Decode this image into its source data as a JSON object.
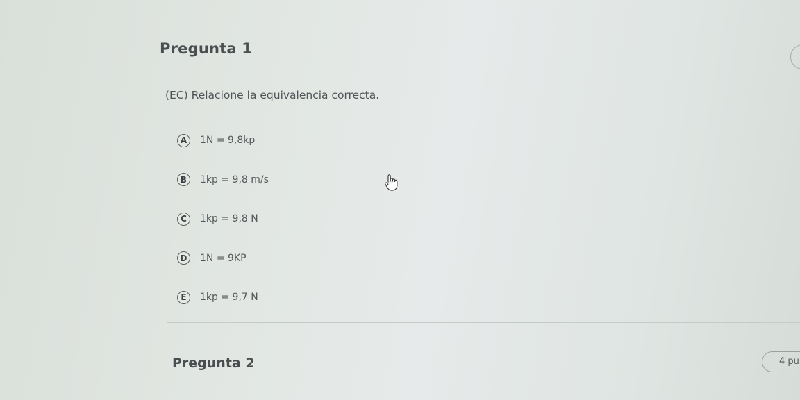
{
  "question1": {
    "title": "Pregunta 1",
    "text": "(EC) Relacione la equivalencia correcta.",
    "options": [
      {
        "letter": "A",
        "text": "1N = 9,8kp"
      },
      {
        "letter": "B",
        "text": "1kp = 9,8 m/s"
      },
      {
        "letter": "C",
        "text": "1kp = 9,8 N"
      },
      {
        "letter": "D",
        "text": "1N = 9KP"
      },
      {
        "letter": "E",
        "text": "1kp = 9,7 N"
      }
    ]
  },
  "question2": {
    "title": "Pregunta 2",
    "points": "4 pu"
  },
  "icons": {
    "cursor": "hand-pointer-icon"
  }
}
